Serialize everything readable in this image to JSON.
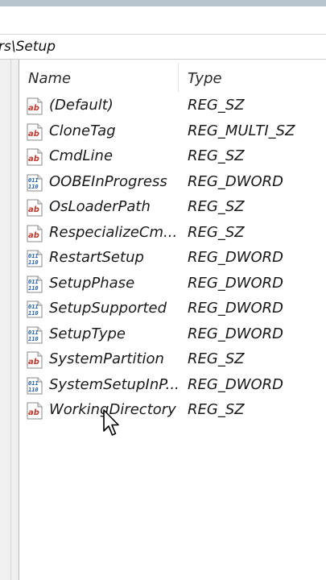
{
  "address": {
    "path": "rs\\Setup"
  },
  "columns": {
    "name": "Name",
    "type": "Type"
  },
  "values": [
    {
      "name": "(Default)",
      "type": "REG_SZ",
      "icon": "string-value-icon"
    },
    {
      "name": "CloneTag",
      "type": "REG_MULTI_SZ",
      "icon": "string-value-icon"
    },
    {
      "name": "CmdLine",
      "type": "REG_SZ",
      "icon": "string-value-icon"
    },
    {
      "name": "OOBEInProgress",
      "type": "REG_DWORD",
      "icon": "binary-value-icon"
    },
    {
      "name": "OsLoaderPath",
      "type": "REG_SZ",
      "icon": "string-value-icon"
    },
    {
      "name": "RespecializeCm...",
      "type": "REG_SZ",
      "icon": "string-value-icon"
    },
    {
      "name": "RestartSetup",
      "type": "REG_DWORD",
      "icon": "binary-value-icon"
    },
    {
      "name": "SetupPhase",
      "type": "REG_DWORD",
      "icon": "binary-value-icon"
    },
    {
      "name": "SetupSupported",
      "type": "REG_DWORD",
      "icon": "binary-value-icon"
    },
    {
      "name": "SetupType",
      "type": "REG_DWORD",
      "icon": "binary-value-icon"
    },
    {
      "name": "SystemPartition",
      "type": "REG_SZ",
      "icon": "string-value-icon"
    },
    {
      "name": "SystemSetupInP...",
      "type": "REG_DWORD",
      "icon": "binary-value-icon"
    },
    {
      "name": "WorkingDirectory",
      "type": "REG_SZ",
      "icon": "string-value-icon"
    }
  ]
}
